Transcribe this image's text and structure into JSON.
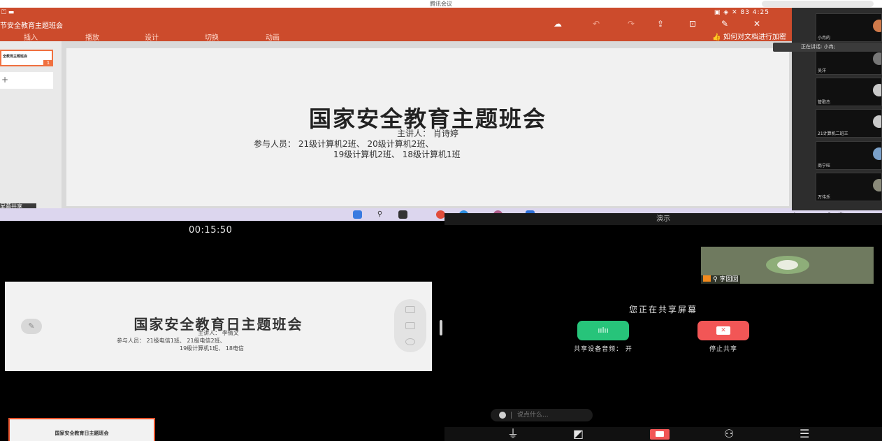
{
  "window": {
    "title": "腾讯会议"
  },
  "ppt": {
    "status_left": "⏍ ▬",
    "status_right": "▣ ◈ ✕ 83 4:25",
    "doc_title": "节安全教育主题班会",
    "tabs": [
      "插入",
      "播放",
      "设计",
      "切换",
      "动画"
    ],
    "help_text": "如何对文档进行加密",
    "thumb_number": "1",
    "thumb_text": "全教育主题班会",
    "thumb2_symbol": "+",
    "share_tag": "屏幕共享",
    "slide": {
      "title": "国家安全教育主题班会",
      "line1": "主讲人： 肖诗婷",
      "line2": "参与人员： 21级计算机2班、 20级计算机2班、",
      "line3": "19级计算机2班、 18级计算机1班"
    }
  },
  "participants": {
    "speaking": "正在讲话: 小冉;",
    "tiles": [
      {
        "label": "小冉的"
      },
      {
        "label": "吴洋"
      },
      {
        "label": "管歌杰"
      },
      {
        "label": "21计算机二班王"
      },
      {
        "label": "商宁旺"
      },
      {
        "label": "万伟乐"
      }
    ]
  },
  "taskbar": {
    "tray": "^ ▣ ⊙ ⚲ 中 ◈ ◁ ▮"
  },
  "left_panel": {
    "timer": "00:15:50",
    "preview": {
      "title": "国家安全教育日主题班会",
      "line1": "主讲人： 李倩文",
      "line2": "参与人员： 21级电信1班、 21级电信2班、",
      "line3": "19级计算机1班、 18电信"
    },
    "mini_title": "国家安全教育日主题班会"
  },
  "right_panel": {
    "top_label": "演示",
    "camera_name": "李囡囡",
    "sharing_message": "您正在共享屏幕",
    "audio_label": "共享设备音频： 开",
    "stop_label": "停止共享",
    "chat_placeholder": "说点什么..."
  },
  "colors": {
    "ppt_orange": "#cc4b2c",
    "green": "#27c47a",
    "red": "#f25656",
    "host_orange": "#f38a1d"
  }
}
